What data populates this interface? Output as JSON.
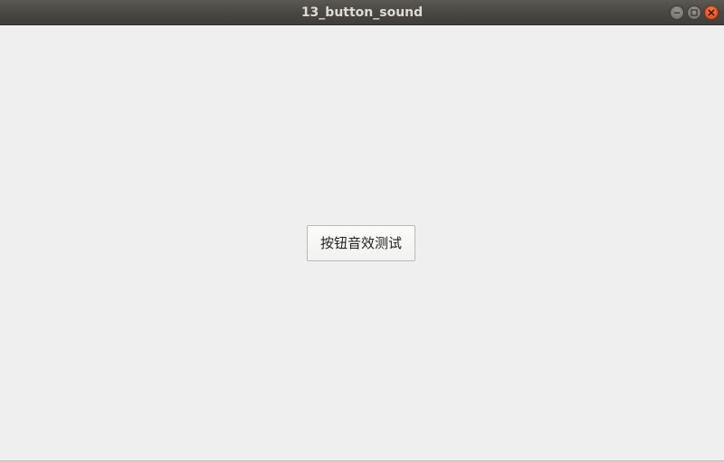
{
  "window": {
    "title": "13_button_sound",
    "controls": {
      "minimize_icon": "minimize-icon",
      "maximize_icon": "maximize-icon",
      "close_icon": "close-icon"
    }
  },
  "main": {
    "button_label": "按钮音效测试"
  },
  "colors": {
    "titlebar": "#4a4944",
    "content_background": "#efefef",
    "close_button": "#e9541f",
    "title_text": "#dfdbd2"
  }
}
